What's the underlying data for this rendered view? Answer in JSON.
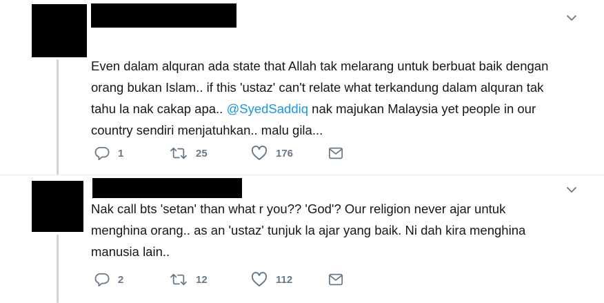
{
  "tweets": [
    {
      "text_before": "Even dalam alquran ada state that Allah tak melarang untuk berbuat baik dengan\norang bukan Islam.. if this 'ustaz' can't relate what terkandung dalam alquran tak\ntahu la nak cakap apa.. ",
      "mention": "@SyedSaddiq",
      "text_after": " nak majukan Malaysia yet people in our\ncountry sendiri menjatuhkan.. malu gila...",
      "replies": "1",
      "retweets": "25",
      "likes": "176"
    },
    {
      "text_before": "Nak call bts 'setan' than what r you?? 'God'? Our religion never ajar untuk\nmenghina orang.. as an 'ustaz' tunjuk la ajar yang baik. Ni dah kira menghina\nmanusia lain..",
      "mention": "",
      "text_after": "",
      "replies": "2",
      "retweets": "12",
      "likes": "112"
    }
  ],
  "icons": {
    "reply": "reply-icon",
    "retweet": "retweet-icon",
    "like": "heart-icon",
    "direct_message": "envelope-icon",
    "more": "chevron-down-icon"
  },
  "colors": {
    "text": "#14171a",
    "mention": "#1b95e0",
    "icon": "#657786",
    "thread_line": "#ccd6dd",
    "redaction": "#000000"
  }
}
